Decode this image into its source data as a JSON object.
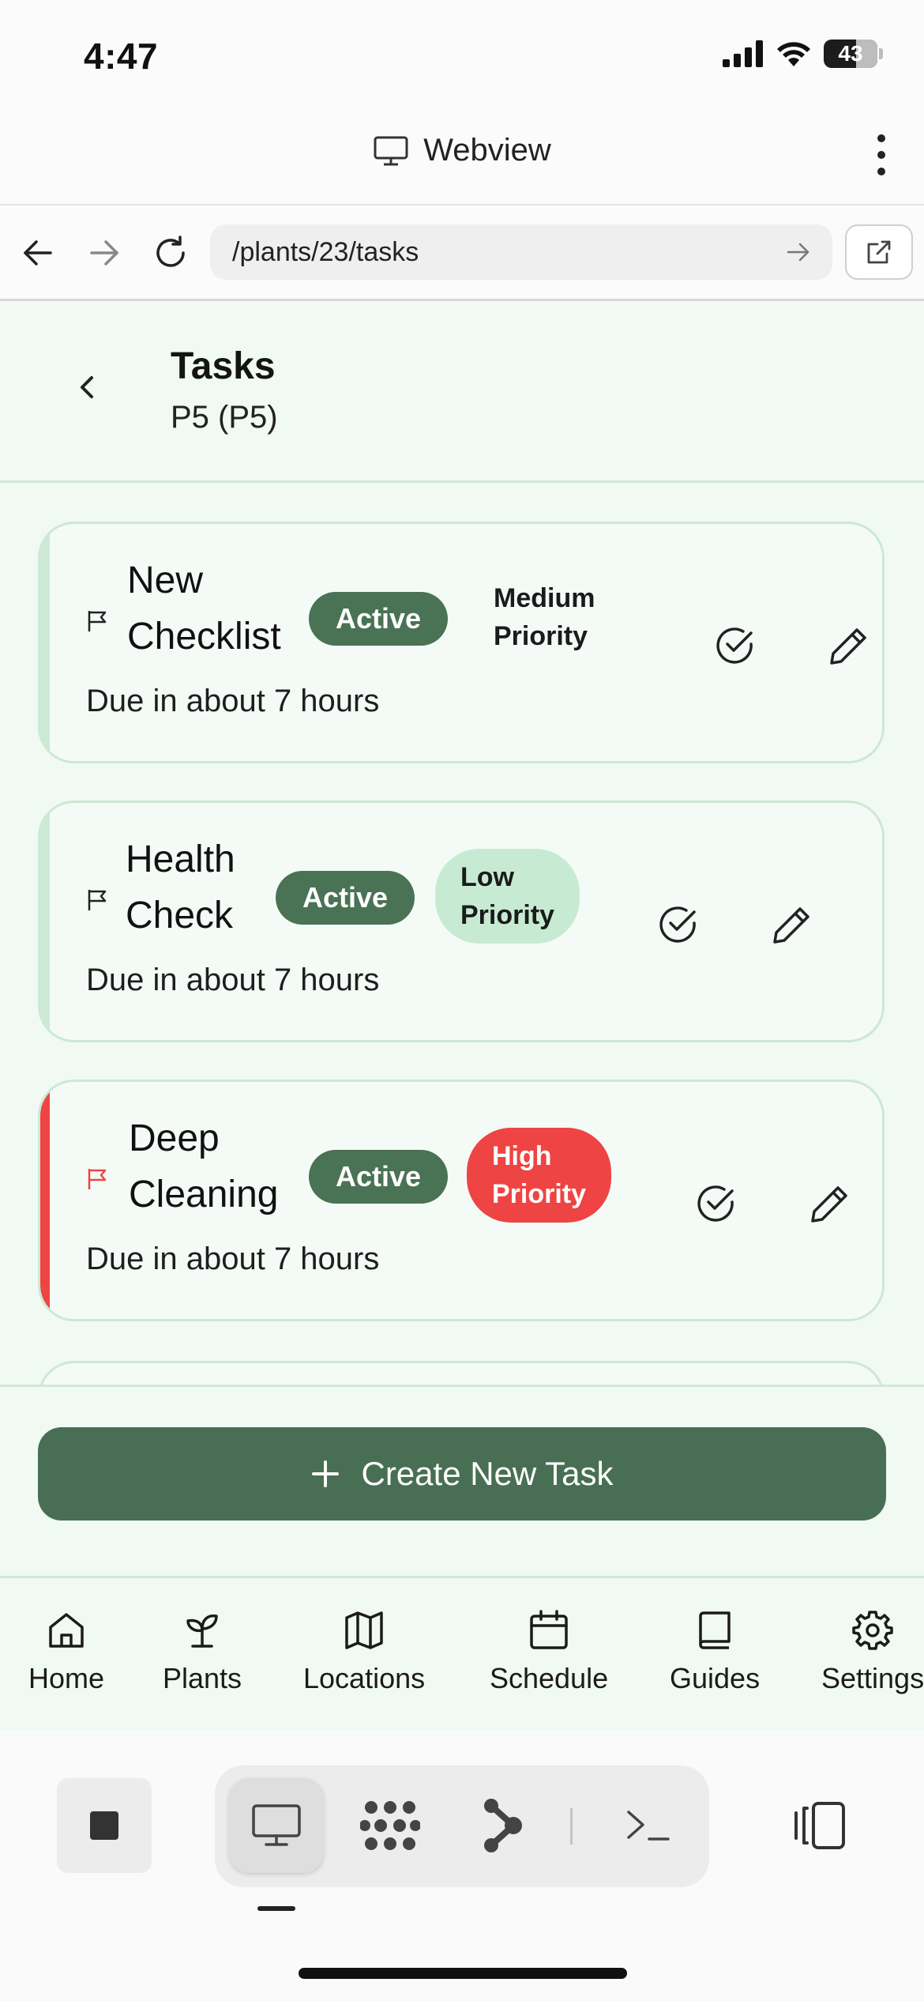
{
  "status_bar": {
    "time": "4:47",
    "battery": "43"
  },
  "webview": {
    "title": "Webview",
    "url": "/plants/23/tasks"
  },
  "page": {
    "title": "Tasks",
    "subtitle": "P5 (P5)"
  },
  "tasks": [
    {
      "title_line1": "New",
      "title_line2": "Checklist",
      "status": "Active",
      "priority_line1": "Medium",
      "priority_line2": "Priority",
      "priority_level": "medium",
      "due": "Due in about 7 hours"
    },
    {
      "title_line1": "Health",
      "title_line2": "Check",
      "status": "Active",
      "priority_line1": "Low",
      "priority_line2": "Priority",
      "priority_level": "low",
      "due": "Due in about 7 hours"
    },
    {
      "title_line1": "Deep",
      "title_line2": "Cleaning",
      "status": "Active",
      "priority_line1": "High",
      "priority_line2": "Priority",
      "priority_level": "high",
      "due": "Due in about 7 hours"
    }
  ],
  "create_button": {
    "label": "Create New Task"
  },
  "tabbar": [
    {
      "label": "Home",
      "icon": "home-icon"
    },
    {
      "label": "Plants",
      "icon": "sprout-icon"
    },
    {
      "label": "Locations",
      "icon": "map-icon"
    },
    {
      "label": "Schedule",
      "icon": "calendar-icon"
    },
    {
      "label": "Guides",
      "icon": "book-icon"
    },
    {
      "label": "Settings",
      "icon": "gear-icon"
    }
  ],
  "colors": {
    "accent": "#486f53",
    "high_priority": "#ef4444",
    "low_priority_bg": "#c7ebd2",
    "card_border": "#cbe9d4",
    "app_bg": "#f1f9f3"
  }
}
